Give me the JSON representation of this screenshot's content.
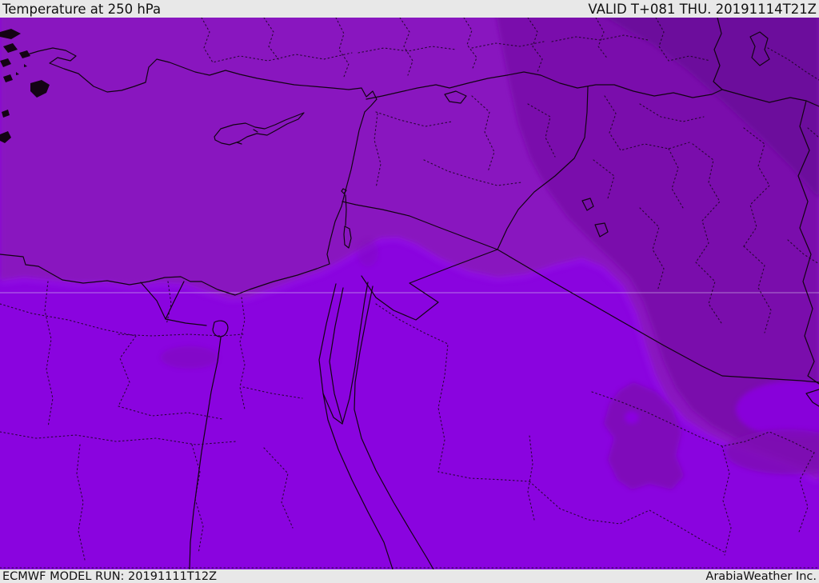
{
  "header": {
    "title": "Temperature at 250 hPa",
    "valid_time": "VALID T+081 THU. 20191114T21Z"
  },
  "footer": {
    "model_run": "ECMWF MODEL RUN: 20191111T12Z",
    "attribution": "ArabiaWeather Inc."
  },
  "map": {
    "description": "Filled temperature shading over Middle East / Eastern Mediterranean",
    "bar_background": "#e8e8e8",
    "text_color": "#111111",
    "band_colors": {
      "south_bright": "#8A04DF",
      "north_medium": "#8912BF",
      "northeast_dark": "#7A0CAC",
      "corner_darkest": "#6C0A9C",
      "rim_highlight": "#A133E8",
      "patch_dark": "#7E10B4"
    },
    "gridline_color": "#DCCFF0",
    "border_line_color": "#120312"
  }
}
